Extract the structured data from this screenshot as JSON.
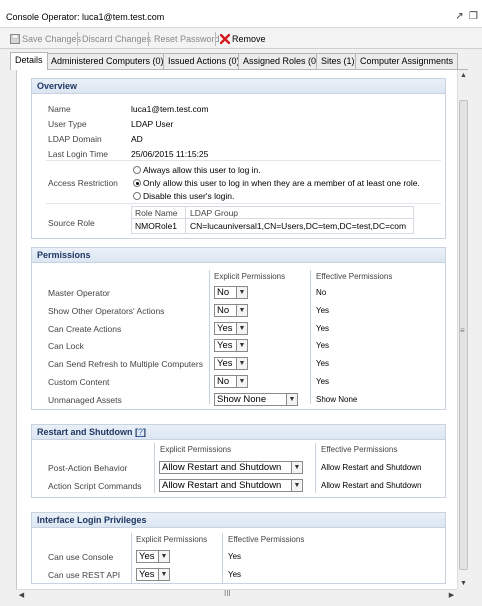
{
  "window": {
    "title": "Console Operator: luca1@tem.test.com"
  },
  "toolbar": {
    "save": "Save Changes",
    "discard": "Discard Changes",
    "reset": "Reset Password",
    "remove": "Remove"
  },
  "tabs": [
    "Details",
    "Administered Computers (0)",
    "Issued Actions (0)",
    "Assigned Roles (0)",
    "Sites (1)",
    "Computer Assignments"
  ],
  "overview": {
    "title": "Overview",
    "name_label": "Name",
    "name": "luca1@tem.test.com",
    "user_type_label": "User Type",
    "user_type": "LDAP User",
    "ldap_domain_label": "LDAP Domain",
    "ldap_domain": "AD",
    "last_login_label": "Last Login Time",
    "last_login": "25/06/2015 11:15:25",
    "access_restriction_label": "Access Restriction",
    "access_options": [
      "Always allow this user to log in.",
      "Only allow this user to log in when they are a member of at least one role.",
      "Disable this user's login."
    ],
    "access_selected": 1,
    "source_role_label": "Source Role",
    "role_table": {
      "col_role": "Role Name",
      "col_group": "LDAP Group",
      "role": "NMORole1",
      "group": "CN=lucauniversal1,CN=Users,DC=tem,DC=test,DC=com"
    }
  },
  "permissions": {
    "title": "Permissions",
    "col_explicit": "Explicit Permissions",
    "col_effective": "Effective Permissions",
    "rows": [
      {
        "label": "Master Operator",
        "explicit": "No",
        "effective": "No"
      },
      {
        "label": "Show Other Operators' Actions",
        "explicit": "No",
        "effective": "Yes"
      },
      {
        "label": "Can Create Actions",
        "explicit": "Yes",
        "effective": "Yes"
      },
      {
        "label": "Can Lock",
        "explicit": "Yes",
        "effective": "Yes"
      },
      {
        "label": "Can Send Refresh to Multiple Computers",
        "explicit": "Yes",
        "effective": "Yes"
      },
      {
        "label": "Custom Content",
        "explicit": "No",
        "effective": "Yes"
      },
      {
        "label": "Unmanaged Assets",
        "explicit": "Show None",
        "effective": "Show None"
      }
    ]
  },
  "restart": {
    "title": "Restart and Shutdown [",
    "help": "?",
    "title_end": "]",
    "col_explicit": "Explicit Permissions",
    "col_effective": "Effective Permissions",
    "rows": [
      {
        "label": "Post-Action Behavior",
        "explicit": "Allow Restart and Shutdown",
        "effective": "Allow Restart and Shutdown"
      },
      {
        "label": "Action Script Commands",
        "explicit": "Allow Restart and Shutdown",
        "effective": "Allow Restart and Shutdown"
      }
    ]
  },
  "interface": {
    "title": "Interface Login Privileges",
    "col_explicit": "Explicit Permissions",
    "col_effective": "Effective Permissions",
    "rows": [
      {
        "label": "Can use Console",
        "explicit": "Yes",
        "effective": "Yes"
      },
      {
        "label": "Can use REST API",
        "explicit": "Yes",
        "effective": "Yes"
      }
    ]
  },
  "scroll": {
    "v_grip": "≡",
    "h_grip": "III"
  }
}
